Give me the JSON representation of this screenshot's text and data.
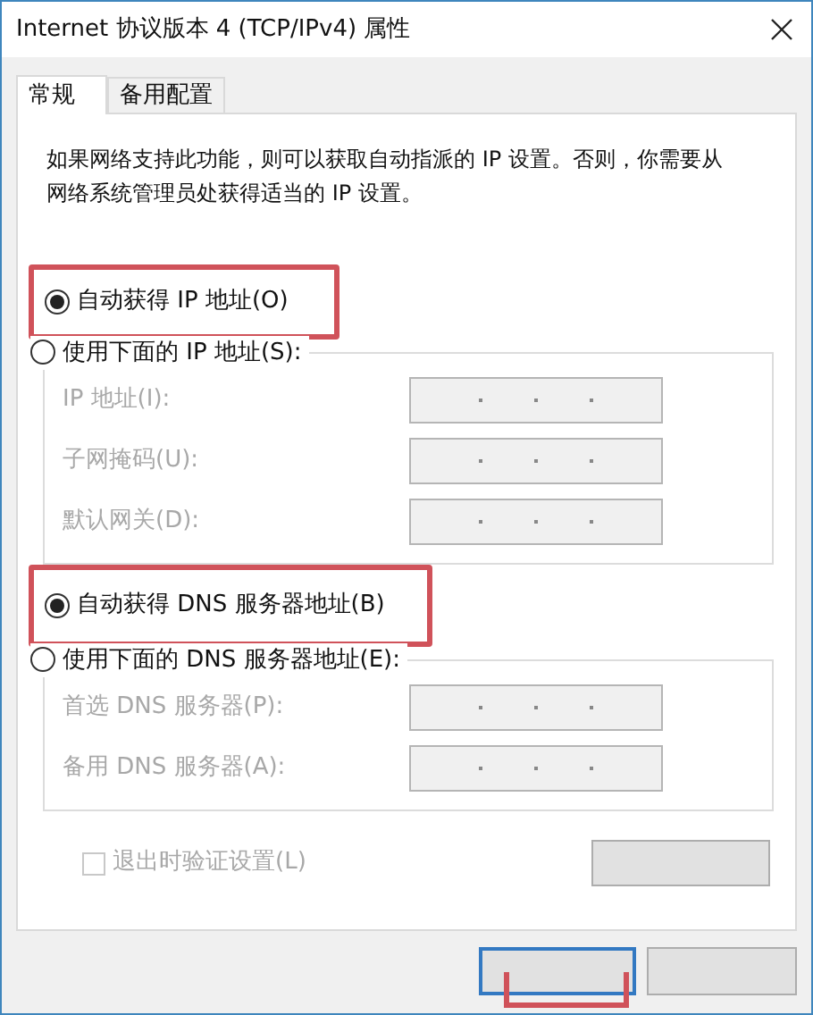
{
  "window": {
    "title": "Internet 协议版本 4 (TCP/IPv4) 属性"
  },
  "tabs": [
    {
      "label": "常规",
      "selected": true
    },
    {
      "label": "备用配置",
      "selected": false
    }
  ],
  "description": "如果网络支持此功能，则可以获取自动指派的 IP 设置。否则，你需要从网络系统管理员处获得适当的 IP 设置。",
  "ip_section": {
    "auto_option": {
      "label": "自动获得 IP 地址(O)",
      "selected": true,
      "highlighted": true
    },
    "manual_option": {
      "label": "使用下面的 IP 地址(S):",
      "selected": false
    },
    "fields": [
      {
        "label": "IP 地址(I):",
        "disabled": true
      },
      {
        "label": "子网掩码(U):",
        "disabled": true
      },
      {
        "label": "默认网关(D):",
        "disabled": true
      }
    ]
  },
  "dns_section": {
    "auto_option": {
      "label": "自动获得 DNS 服务器地址(B)",
      "selected": true,
      "highlighted": true
    },
    "manual_option": {
      "label": "使用下面的 DNS 服务器地址(E):",
      "selected": false
    },
    "fields": [
      {
        "label": "首选 DNS 服务器(P):",
        "disabled": true
      },
      {
        "label": "备用 DNS 服务器(A):",
        "disabled": true
      }
    ]
  },
  "validate_checkbox": {
    "label": "退出时验证设置(L)",
    "checked": false,
    "disabled": true
  },
  "buttons": [
    {
      "kind": "advanced"
    },
    {
      "kind": "ok",
      "highlighted": true
    },
    {
      "kind": "cancel"
    }
  ]
}
